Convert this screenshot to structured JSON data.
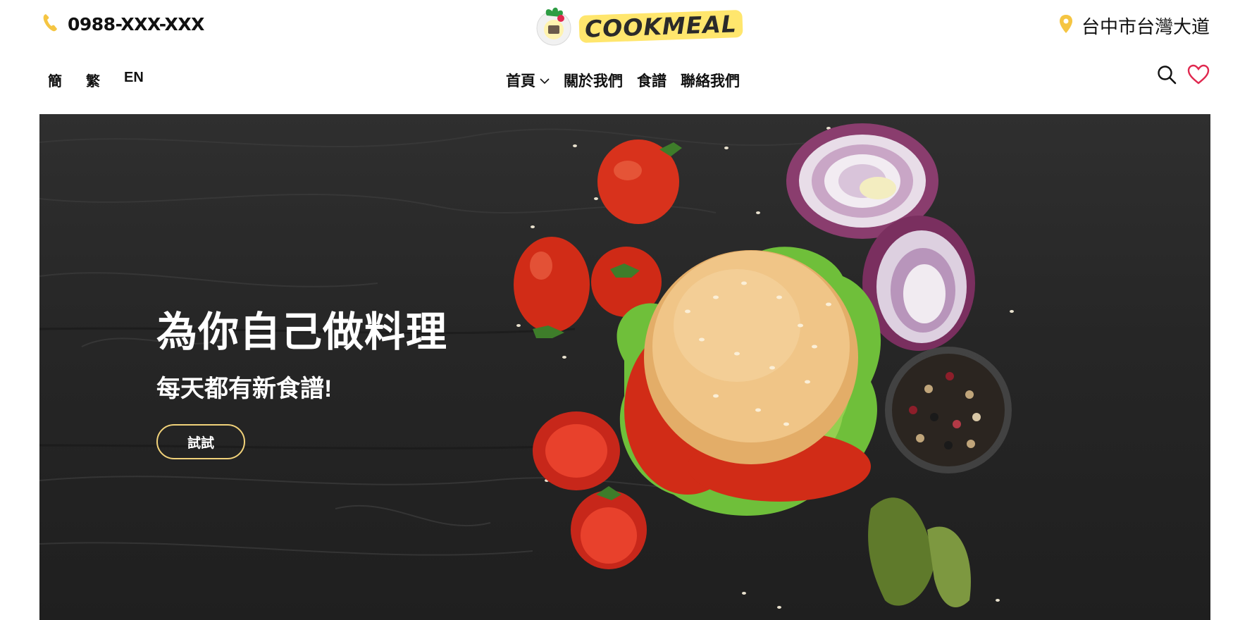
{
  "header": {
    "phone": "0988-XXX-XXX",
    "logo_text": "COOKMEAL",
    "address": "台中市台灣大道"
  },
  "nav": {
    "languages": [
      "簡",
      "繁",
      "EN"
    ],
    "menu": [
      {
        "label": "首頁"
      },
      {
        "label": "關於我們"
      },
      {
        "label": "食譜"
      },
      {
        "label": "聯絡我們"
      }
    ]
  },
  "hero": {
    "title": "為你自己做料理",
    "subtitle": "每天都有新食譜!",
    "button": "試試"
  },
  "colors": {
    "accent_yellow": "#f5c542",
    "button_border": "#f1d27a",
    "heart_red": "#e0284f",
    "hero_bg": "#262626"
  },
  "icons": [
    "phone-icon",
    "map-pin-icon",
    "chevron-down-icon",
    "search-icon",
    "heart-icon"
  ]
}
